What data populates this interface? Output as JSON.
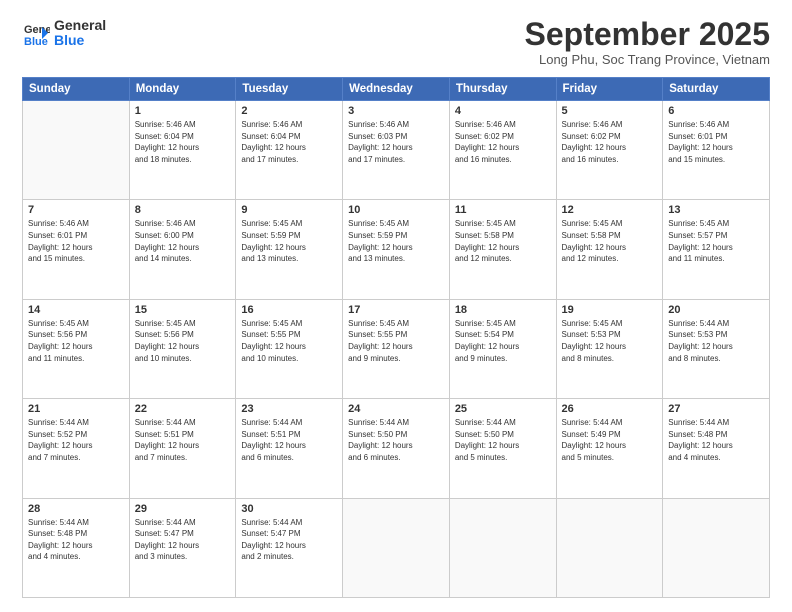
{
  "header": {
    "logo_line1": "General",
    "logo_line2": "Blue",
    "month_title": "September 2025",
    "subtitle": "Long Phu, Soc Trang Province, Vietnam"
  },
  "weekdays": [
    "Sunday",
    "Monday",
    "Tuesday",
    "Wednesday",
    "Thursday",
    "Friday",
    "Saturday"
  ],
  "weeks": [
    [
      {
        "date": "",
        "info": ""
      },
      {
        "date": "1",
        "info": "Sunrise: 5:46 AM\nSunset: 6:04 PM\nDaylight: 12 hours\nand 18 minutes."
      },
      {
        "date": "2",
        "info": "Sunrise: 5:46 AM\nSunset: 6:04 PM\nDaylight: 12 hours\nand 17 minutes."
      },
      {
        "date": "3",
        "info": "Sunrise: 5:46 AM\nSunset: 6:03 PM\nDaylight: 12 hours\nand 17 minutes."
      },
      {
        "date": "4",
        "info": "Sunrise: 5:46 AM\nSunset: 6:02 PM\nDaylight: 12 hours\nand 16 minutes."
      },
      {
        "date": "5",
        "info": "Sunrise: 5:46 AM\nSunset: 6:02 PM\nDaylight: 12 hours\nand 16 minutes."
      },
      {
        "date": "6",
        "info": "Sunrise: 5:46 AM\nSunset: 6:01 PM\nDaylight: 12 hours\nand 15 minutes."
      }
    ],
    [
      {
        "date": "7",
        "info": "Sunrise: 5:46 AM\nSunset: 6:01 PM\nDaylight: 12 hours\nand 15 minutes."
      },
      {
        "date": "8",
        "info": "Sunrise: 5:46 AM\nSunset: 6:00 PM\nDaylight: 12 hours\nand 14 minutes."
      },
      {
        "date": "9",
        "info": "Sunrise: 5:45 AM\nSunset: 5:59 PM\nDaylight: 12 hours\nand 13 minutes."
      },
      {
        "date": "10",
        "info": "Sunrise: 5:45 AM\nSunset: 5:59 PM\nDaylight: 12 hours\nand 13 minutes."
      },
      {
        "date": "11",
        "info": "Sunrise: 5:45 AM\nSunset: 5:58 PM\nDaylight: 12 hours\nand 12 minutes."
      },
      {
        "date": "12",
        "info": "Sunrise: 5:45 AM\nSunset: 5:58 PM\nDaylight: 12 hours\nand 12 minutes."
      },
      {
        "date": "13",
        "info": "Sunrise: 5:45 AM\nSunset: 5:57 PM\nDaylight: 12 hours\nand 11 minutes."
      }
    ],
    [
      {
        "date": "14",
        "info": "Sunrise: 5:45 AM\nSunset: 5:56 PM\nDaylight: 12 hours\nand 11 minutes."
      },
      {
        "date": "15",
        "info": "Sunrise: 5:45 AM\nSunset: 5:56 PM\nDaylight: 12 hours\nand 10 minutes."
      },
      {
        "date": "16",
        "info": "Sunrise: 5:45 AM\nSunset: 5:55 PM\nDaylight: 12 hours\nand 10 minutes."
      },
      {
        "date": "17",
        "info": "Sunrise: 5:45 AM\nSunset: 5:55 PM\nDaylight: 12 hours\nand 9 minutes."
      },
      {
        "date": "18",
        "info": "Sunrise: 5:45 AM\nSunset: 5:54 PM\nDaylight: 12 hours\nand 9 minutes."
      },
      {
        "date": "19",
        "info": "Sunrise: 5:45 AM\nSunset: 5:53 PM\nDaylight: 12 hours\nand 8 minutes."
      },
      {
        "date": "20",
        "info": "Sunrise: 5:44 AM\nSunset: 5:53 PM\nDaylight: 12 hours\nand 8 minutes."
      }
    ],
    [
      {
        "date": "21",
        "info": "Sunrise: 5:44 AM\nSunset: 5:52 PM\nDaylight: 12 hours\nand 7 minutes."
      },
      {
        "date": "22",
        "info": "Sunrise: 5:44 AM\nSunset: 5:51 PM\nDaylight: 12 hours\nand 7 minutes."
      },
      {
        "date": "23",
        "info": "Sunrise: 5:44 AM\nSunset: 5:51 PM\nDaylight: 12 hours\nand 6 minutes."
      },
      {
        "date": "24",
        "info": "Sunrise: 5:44 AM\nSunset: 5:50 PM\nDaylight: 12 hours\nand 6 minutes."
      },
      {
        "date": "25",
        "info": "Sunrise: 5:44 AM\nSunset: 5:50 PM\nDaylight: 12 hours\nand 5 minutes."
      },
      {
        "date": "26",
        "info": "Sunrise: 5:44 AM\nSunset: 5:49 PM\nDaylight: 12 hours\nand 5 minutes."
      },
      {
        "date": "27",
        "info": "Sunrise: 5:44 AM\nSunset: 5:48 PM\nDaylight: 12 hours\nand 4 minutes."
      }
    ],
    [
      {
        "date": "28",
        "info": "Sunrise: 5:44 AM\nSunset: 5:48 PM\nDaylight: 12 hours\nand 4 minutes."
      },
      {
        "date": "29",
        "info": "Sunrise: 5:44 AM\nSunset: 5:47 PM\nDaylight: 12 hours\nand 3 minutes."
      },
      {
        "date": "30",
        "info": "Sunrise: 5:44 AM\nSunset: 5:47 PM\nDaylight: 12 hours\nand 2 minutes."
      },
      {
        "date": "",
        "info": ""
      },
      {
        "date": "",
        "info": ""
      },
      {
        "date": "",
        "info": ""
      },
      {
        "date": "",
        "info": ""
      }
    ]
  ]
}
